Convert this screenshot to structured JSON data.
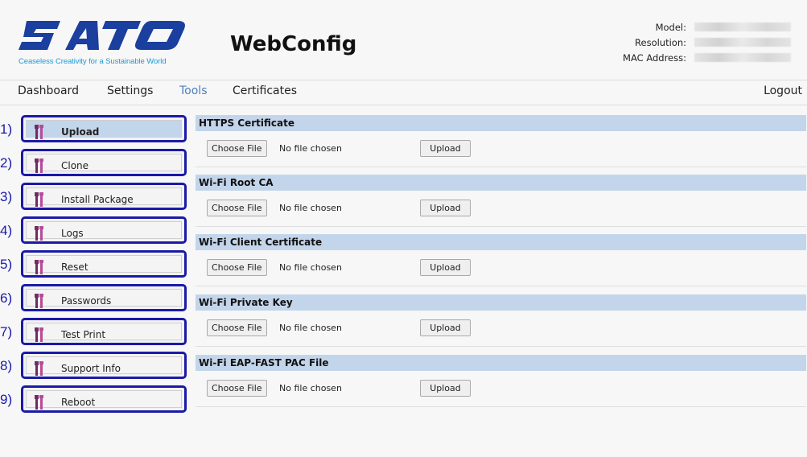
{
  "colors": {
    "brand_blue": "#1c9ad6",
    "logo_navy": "#1b3f9e",
    "highlight": "#c3d5ea",
    "annotation": "#1a1aa8",
    "active_nav": "#4d7fc2"
  },
  "brand": {
    "logo_text": "SATO",
    "tagline": "Ceaseless Creativity for a Sustainable World"
  },
  "app_title": "WebConfig",
  "device_info": {
    "model_label": "Model:",
    "resolution_label": "Resolution:",
    "mac_label": "MAC Address:"
  },
  "nav": {
    "dashboard": "Dashboard",
    "settings": "Settings",
    "tools": "Tools",
    "certificates": "Certificates",
    "logout": "Logout"
  },
  "sidebar": {
    "items": [
      {
        "num": "1)",
        "label": "Upload",
        "icon": "tools-icon"
      },
      {
        "num": "2)",
        "label": "Clone",
        "icon": "tools-icon"
      },
      {
        "num": "3)",
        "label": "Install Package",
        "icon": "tools-icon"
      },
      {
        "num": "4)",
        "label": "Logs",
        "icon": "tools-icon"
      },
      {
        "num": "5)",
        "label": "Reset",
        "icon": "tools-icon"
      },
      {
        "num": "6)",
        "label": "Passwords",
        "icon": "tools-icon"
      },
      {
        "num": "7)",
        "label": "Test Print",
        "icon": "tools-icon"
      },
      {
        "num": "8)",
        "label": "Support Info",
        "icon": "tools-icon"
      },
      {
        "num": "9)",
        "label": "Reboot",
        "icon": "tools-icon"
      }
    ]
  },
  "sections": [
    {
      "title": "HTTPS Certificate",
      "choose_label": "Choose File",
      "file_status": "No file chosen",
      "upload_label": "Upload"
    },
    {
      "title": "Wi-Fi Root CA",
      "choose_label": "Choose File",
      "file_status": "No file chosen",
      "upload_label": "Upload"
    },
    {
      "title": "Wi-Fi Client Certificate",
      "choose_label": "Choose File",
      "file_status": "No file chosen",
      "upload_label": "Upload"
    },
    {
      "title": "Wi-Fi Private Key",
      "choose_label": "Choose File",
      "file_status": "No file chosen",
      "upload_label": "Upload"
    },
    {
      "title": "Wi-Fi EAP-FAST PAC File",
      "choose_label": "Choose File",
      "file_status": "No file chosen",
      "upload_label": "Upload"
    }
  ]
}
